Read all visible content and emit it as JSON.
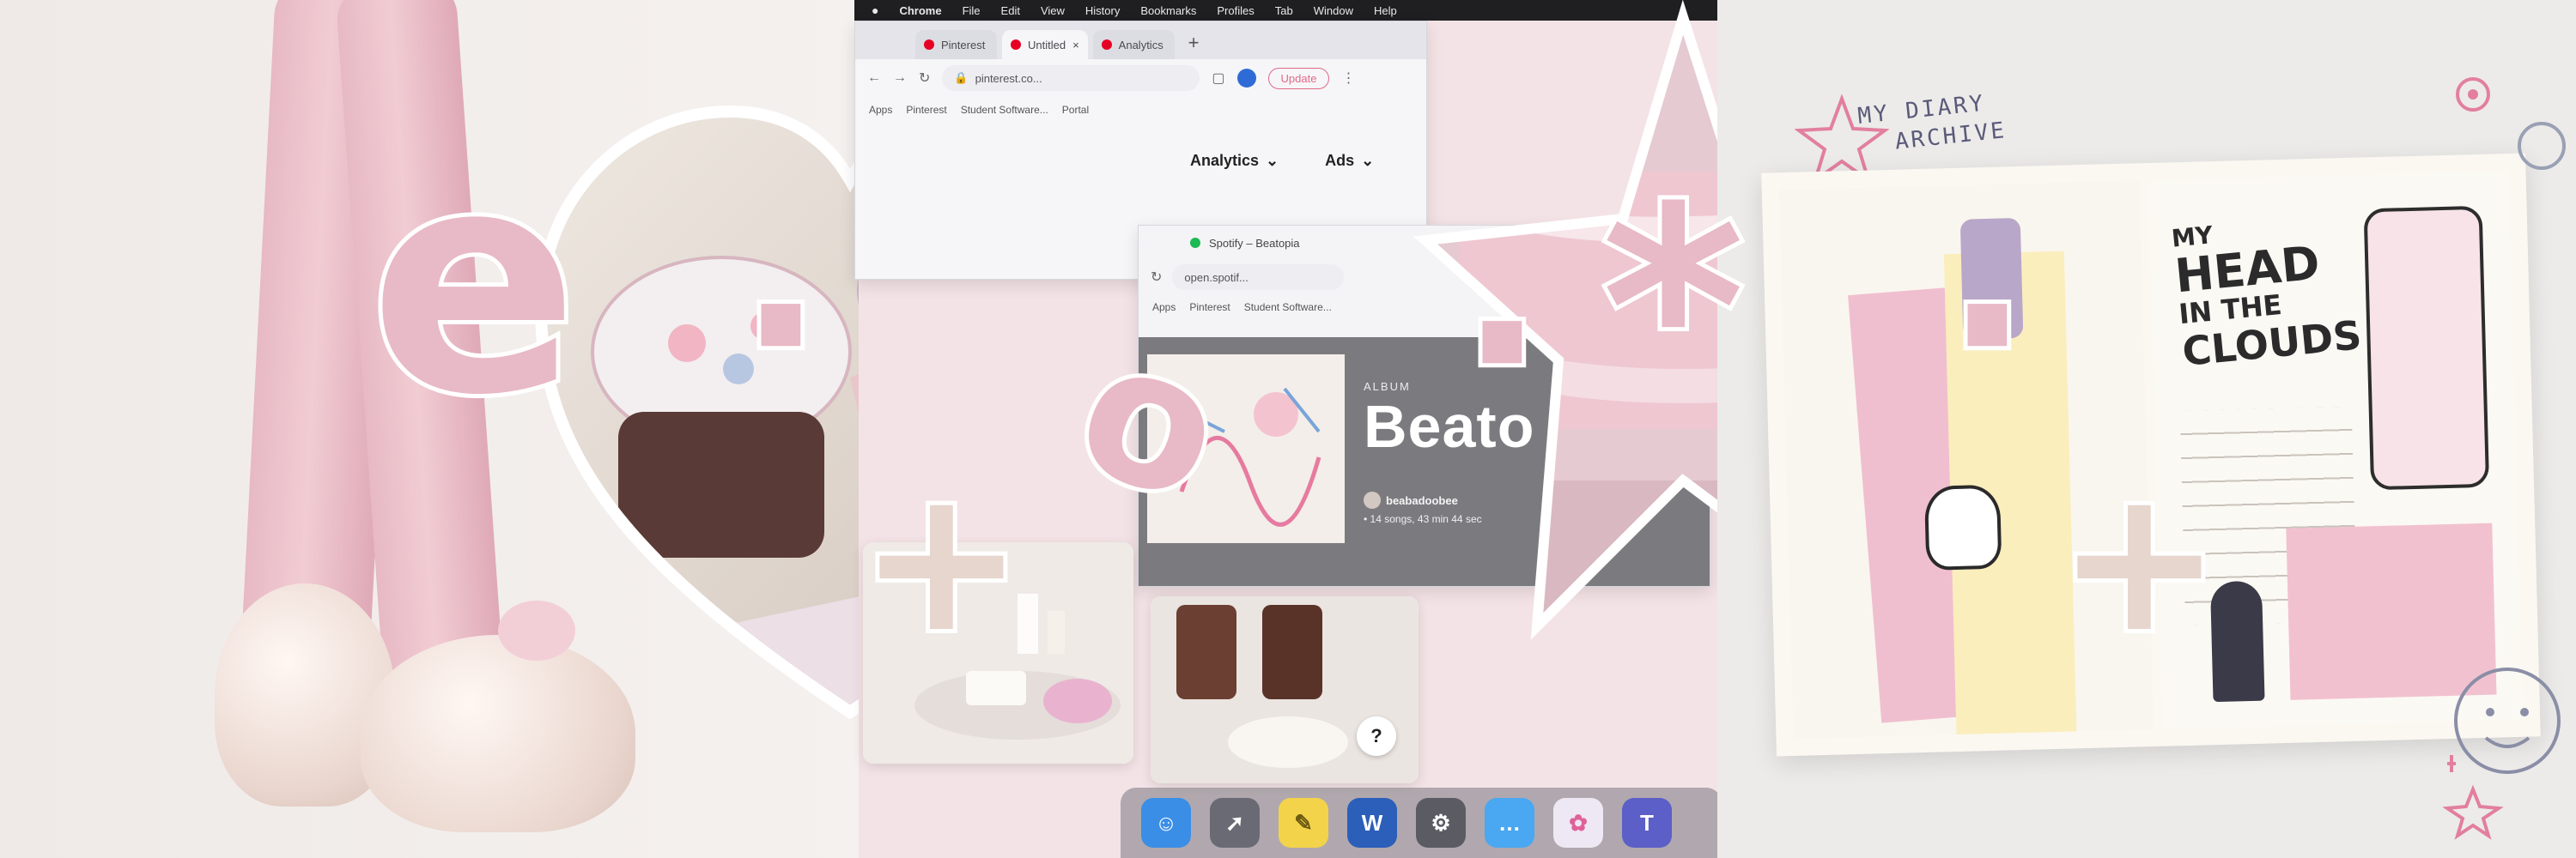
{
  "mac_menu": {
    "brand": "Chrome",
    "items": [
      "File",
      "Edit",
      "View",
      "History",
      "Bookmarks",
      "Profiles",
      "Tab",
      "Window",
      "Help"
    ]
  },
  "pinterest_window": {
    "tabs": [
      "Pinterest",
      "Untitled",
      "Analytics"
    ],
    "new_tab": "+",
    "address": "pinterest.co...",
    "update_button": "Update",
    "bookmarks": [
      "Apps",
      "Pinterest",
      "Student Software...",
      "Portal"
    ],
    "nav": [
      {
        "label": "Analytics"
      },
      {
        "label": "Ads"
      }
    ]
  },
  "spotify_window": {
    "tab_title": "Spotify – Beatopia",
    "address": "open.spotif...",
    "bookmarks": [
      "Apps",
      "Pinterest",
      "Student Software..."
    ],
    "type_label": "ALBUM",
    "album_title": "Beato",
    "artist": "beabadoobee",
    "meta": "• 14 songs, 43 min 44 sec"
  },
  "help_badge": "?",
  "dock_icons": [
    {
      "name": "finder-icon",
      "color": "#3a8ee6",
      "glyph": "☺"
    },
    {
      "name": "launchpad-icon",
      "color": "#6a6a74",
      "glyph": "🚀"
    },
    {
      "name": "stickies-icon",
      "color": "#f3d34a",
      "glyph": "✎"
    },
    {
      "name": "word-icon",
      "color": "#2b5fb9",
      "glyph": "W"
    },
    {
      "name": "system-preferences-icon",
      "color": "#5b5b63",
      "glyph": "⚙"
    },
    {
      "name": "messages-icon",
      "color": "#4aa7f1",
      "glyph": "…"
    },
    {
      "name": "photos-icon",
      "color": "#e9e4f4",
      "glyph": "✿"
    },
    {
      "name": "teams-icon",
      "color": "#5b5fc7",
      "glyph": "T"
    }
  ],
  "diary": {
    "title_line1": "MY DIARY",
    "title_line2": "ARCHIVE",
    "heading_line1": "MY",
    "heading_line2": "HEAD",
    "heading_line3": "IN THE",
    "heading_line4": "CLOUDS"
  },
  "overlay_glyphs": [
    "e",
    "·",
    "o",
    "·",
    "*",
    "·",
    "+",
    "+"
  ],
  "colors": {
    "pink": "#e8b9c6",
    "beige": "#e7d6cd",
    "background": "#f1ebea"
  }
}
